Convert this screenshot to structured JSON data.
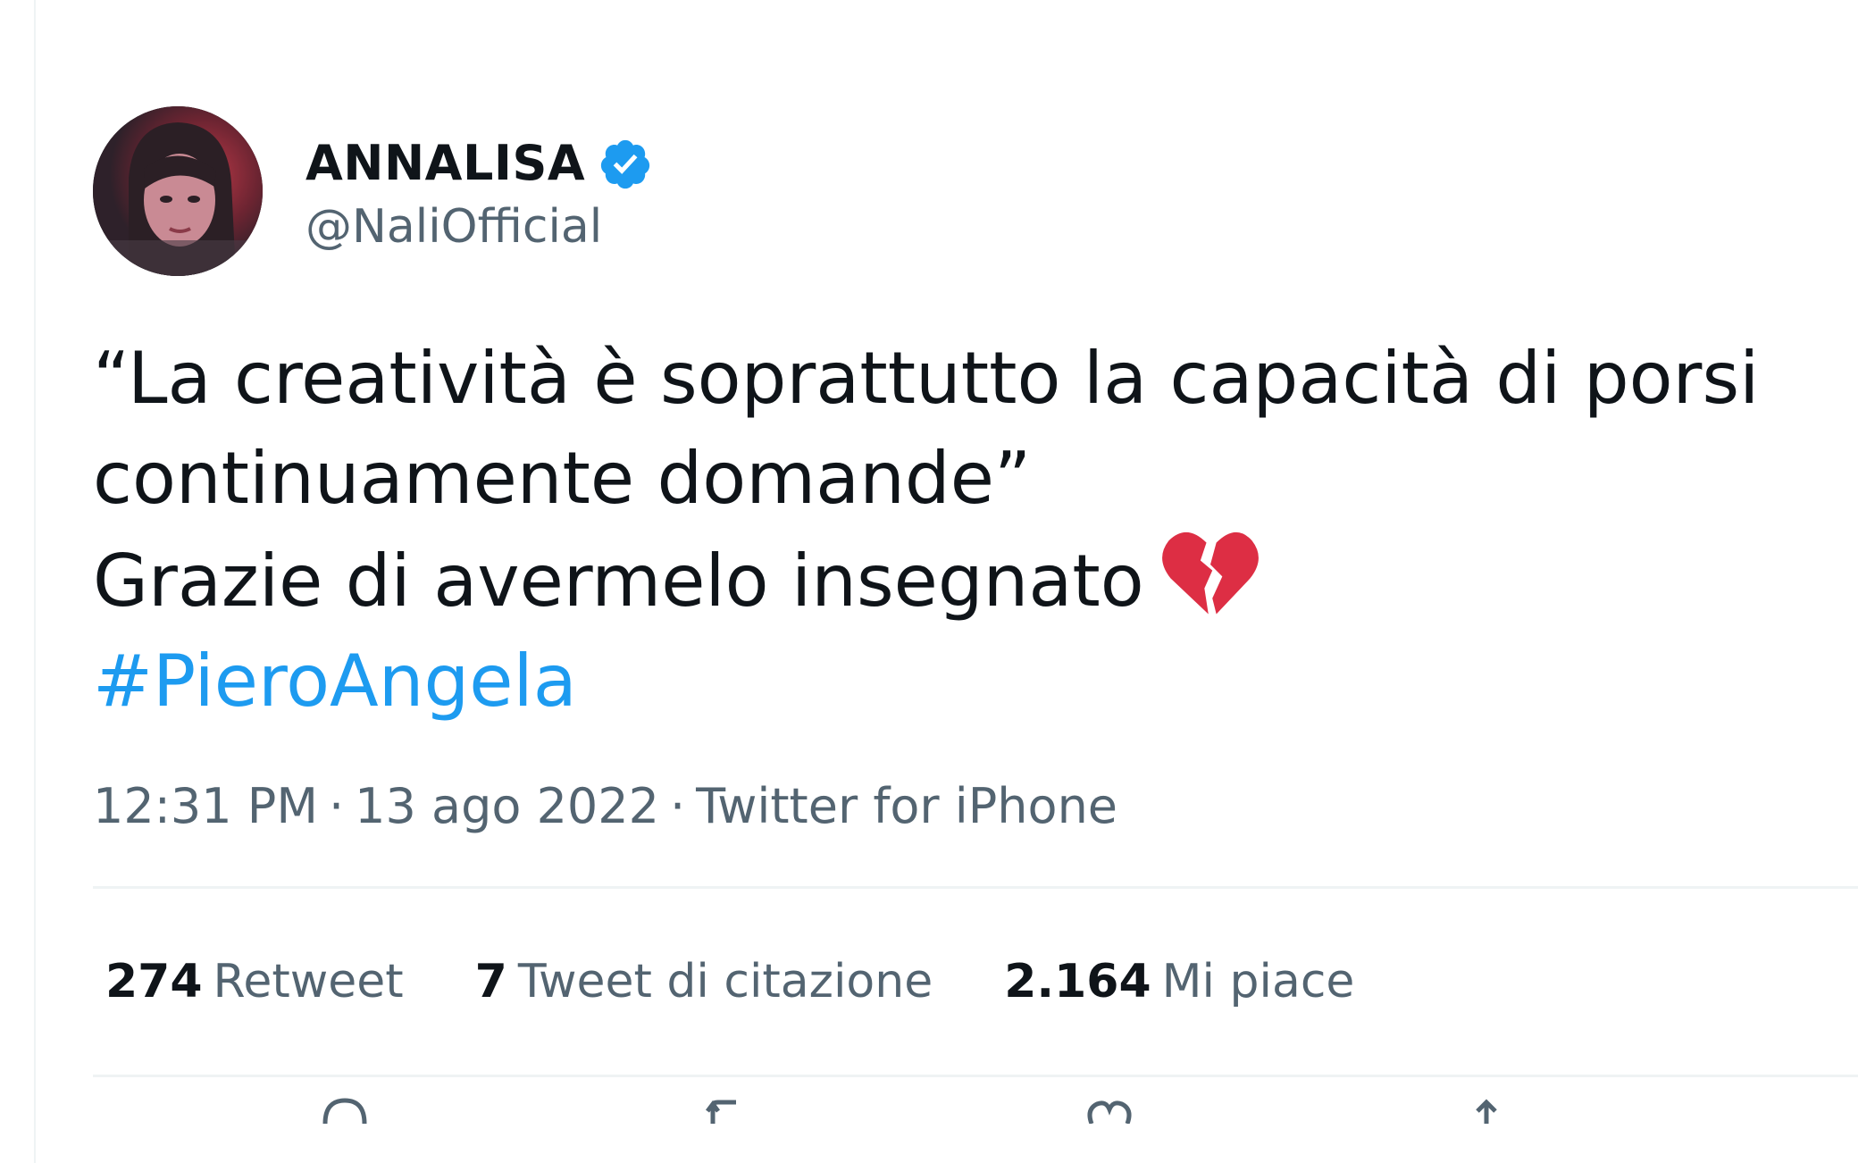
{
  "tweet": {
    "author": {
      "display_name": "ANNALISA",
      "handle": "@NaliOfficial",
      "verified": true
    },
    "text": {
      "line1": "“La creatività è soprattutto la capacità di porsi",
      "line2": "continuamente domande”",
      "line3": "Grazie di avermelo insegnato",
      "hashtag": "#PieroAngela"
    },
    "meta": {
      "time": "12:31 PM",
      "date": "13 ago 2022",
      "source": "Twitter for iPhone",
      "separator": "·"
    },
    "stats": [
      {
        "count": "274",
        "label": "Retweet"
      },
      {
        "count": "7",
        "label": "Tweet di citazione"
      },
      {
        "count": "2.164",
        "label": "Mi piace"
      }
    ],
    "actions": [
      "reply-icon",
      "retweet-icon",
      "like-icon",
      "share-icon"
    ]
  },
  "colors": {
    "text": "#0f1419",
    "secondary": "#536471",
    "link": "#1d9bf0",
    "verified": "#1d9bf0",
    "divider": "#eff3f4",
    "heart": "#dd2e44"
  }
}
